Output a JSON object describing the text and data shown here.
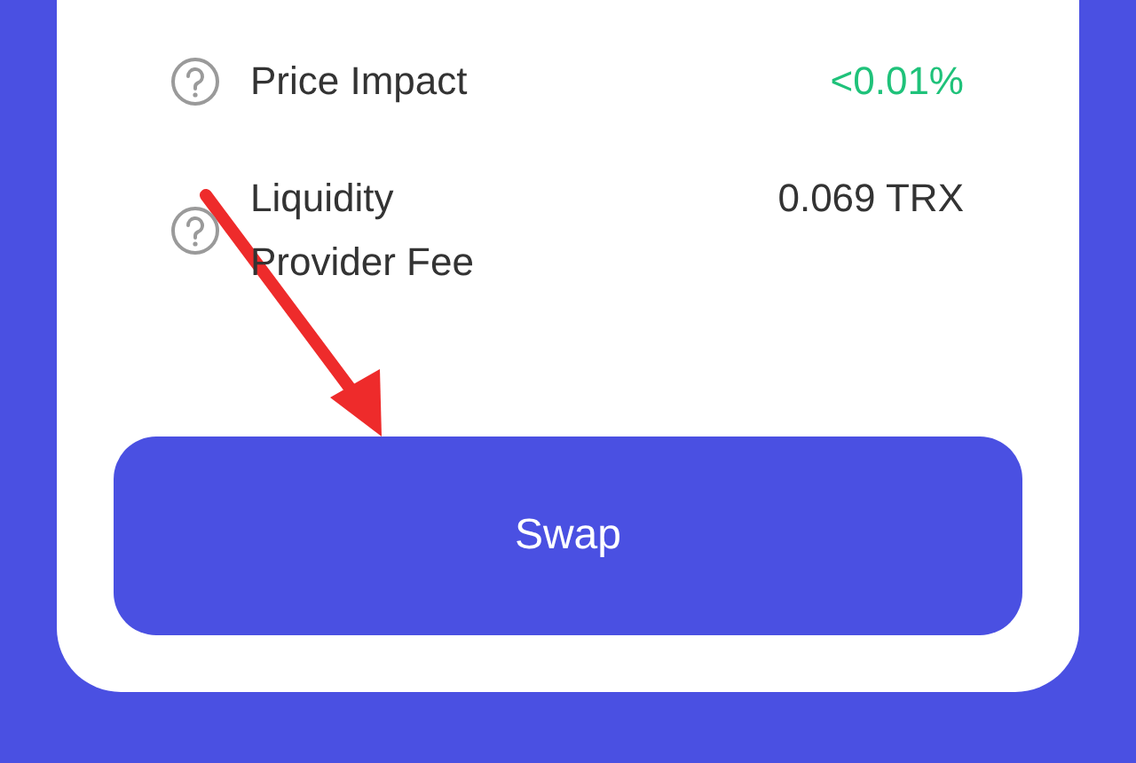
{
  "details": [
    {
      "label": "Price Impact",
      "value": "<0.01%",
      "color": "#1fc27a"
    },
    {
      "label": "Liquidity Provider Fee",
      "value": "0.069 TRX",
      "color": "#333333"
    }
  ],
  "swap_button": {
    "label": "Swap"
  }
}
